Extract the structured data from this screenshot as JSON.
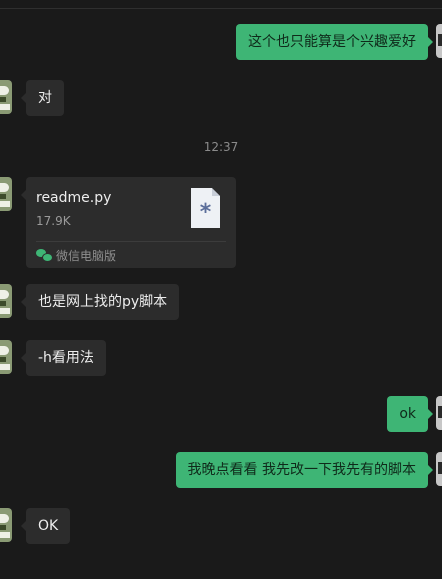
{
  "messages": {
    "m1": {
      "text": "这个也只能算是个兴趣爱好",
      "side": "right"
    },
    "m2": {
      "text": "对",
      "side": "left"
    },
    "timestamp": "12:37",
    "file": {
      "name": "readme.py",
      "size": "17.9K",
      "source": "微信电脑版",
      "icon_glyph": "*"
    },
    "m3": {
      "text": "也是网上找的py脚本",
      "side": "left"
    },
    "m4": {
      "text": "-h看用法",
      "side": "left"
    },
    "m5": {
      "text": "ok",
      "side": "right"
    },
    "m6": {
      "text": "我晚点看看 我先改一下我先有的脚本",
      "side": "right"
    },
    "m7": {
      "text": "OK",
      "side": "left"
    }
  },
  "colors": {
    "background": "#1a1a1a",
    "bubble_left": "#2c2c2c",
    "bubble_right": "#3eb575"
  },
  "icons": {
    "file": "document-icon",
    "source": "wechat-icon",
    "avatar": "avatar"
  }
}
